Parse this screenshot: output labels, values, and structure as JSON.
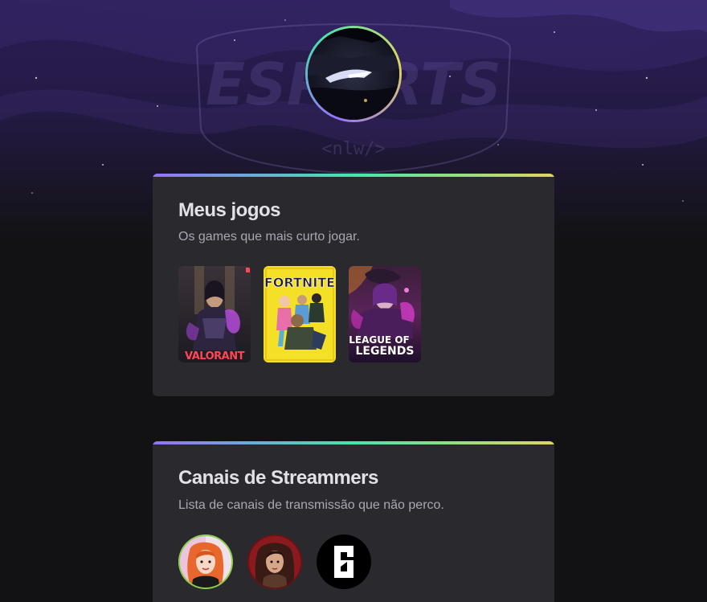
{
  "colors": {
    "background": "#121214",
    "card": "#29292e",
    "gradient_start": "#9572fc",
    "gradient_mid": "#43e7ad",
    "gradient_end": "#e1d55d",
    "text_primary": "#e1e1e6",
    "text_secondary": "#a8a8b3"
  },
  "hero": {
    "background_logo_text": "ESPORTS",
    "background_logo_sub": "<nlw/>",
    "avatar_icon": "profile-avatar"
  },
  "games_section": {
    "title": "Meus jogos",
    "subtitle": "Os games que mais curto jogar.",
    "games": [
      {
        "name": "VALORANT",
        "icon": "valorant-cover"
      },
      {
        "name": "FORTNITE",
        "icon": "fortnite-cover"
      },
      {
        "name_line1": "LEAGUE OF",
        "name_line2": "LEGENDS",
        "icon": "league-of-legends-cover"
      }
    ]
  },
  "streamers_section": {
    "title": "Canais de Streammers",
    "subtitle": "Lista de canais de transmissão que não perco.",
    "streamers": [
      {
        "icon": "streamer-avatar-1"
      },
      {
        "icon": "streamer-avatar-2"
      },
      {
        "icon": "streamer-avatar-3"
      }
    ]
  }
}
